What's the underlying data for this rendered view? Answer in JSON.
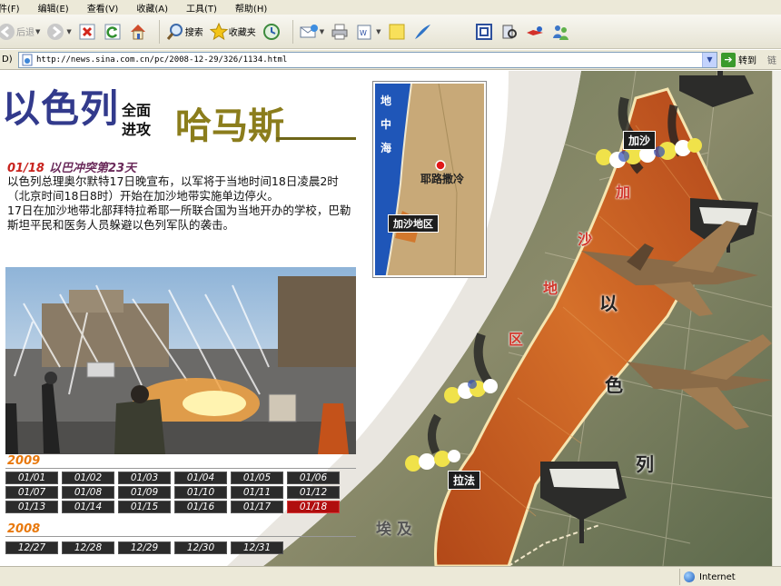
{
  "menu": [
    "查看(V)",
    "收藏(A)",
    "工具(T)",
    "帮助(H)"
  ],
  "menu_partial": [
    "件(F)",
    "编辑(E)"
  ],
  "toolbar": {
    "back_label": "后退",
    "search_label": "搜索",
    "favorites_label": "收藏夹"
  },
  "address": {
    "url": "http://news.sina.com.cn/pc/2008-12-29/326/1134.html",
    "go_label": "转到",
    "links_label": "链"
  },
  "page": {
    "title_main": "以色列",
    "title_sub": "全面进攻",
    "title_target": "哈马斯",
    "headline_date": "01/18",
    "headline_text": "以巴冲突第23天",
    "body": [
      "以色列总理奥尔默特17日晚宣布，以军将于当地时间18日凌晨2时（北京时间18日8时）开始在加沙地带实施单边停火。",
      "17日在加沙地带北部拜特拉希耶一所联合国为当地开办的学校，巴勒斯坦平民和医务人员躲避以色列军队的袭击。"
    ],
    "timeline": [
      {
        "year": "2009",
        "dates": [
          "01/01",
          "01/02",
          "01/03",
          "01/04",
          "01/05",
          "01/06",
          "01/07",
          "01/08",
          "01/09",
          "01/10",
          "01/11",
          "01/12",
          "01/13",
          "01/14",
          "01/15",
          "01/16",
          "01/17",
          "01/18"
        ],
        "active": "01/18"
      },
      {
        "year": "2008",
        "dates": [
          "12/27",
          "12/28",
          "12/29",
          "12/30",
          "12/31"
        ],
        "active": ""
      }
    ],
    "inset_map": {
      "sea_label": [
        "地",
        "中",
        "海"
      ],
      "city_label": "耶路撒冷",
      "region_label": "加沙地区"
    },
    "map_labels": {
      "gaza_city": "加沙",
      "rafah": "拉法",
      "egypt": "埃 及",
      "strip_chars": [
        "加",
        "沙",
        "地",
        "区"
      ],
      "israel_chars": [
        "以",
        "色",
        "列"
      ]
    }
  },
  "status": {
    "text": "",
    "zone": "Internet"
  },
  "colors": {
    "chrome": "#ece9d8",
    "title_blue": "#323a8c",
    "title_gold": "#8b7d1c",
    "date_active": "#b00e0e",
    "year_orange": "#e8780c",
    "strip_orange": "#c8561a"
  }
}
